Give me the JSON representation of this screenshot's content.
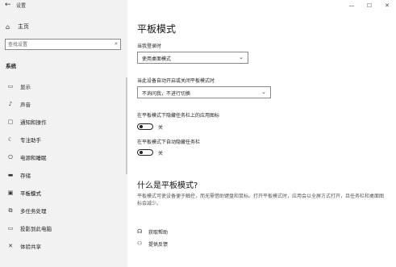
{
  "window": {
    "title": "设置",
    "back_icon": "back-arrow-icon",
    "controls": {
      "minimize": "—",
      "maximize": "☐",
      "close": "✕"
    }
  },
  "sidebar": {
    "home_label": "主页",
    "search_placeholder": "查找设置",
    "section_label": "系统",
    "items": [
      {
        "icon": "display-icon",
        "label": "显示"
      },
      {
        "icon": "sound-icon",
        "label": "声音"
      },
      {
        "icon": "notifications-icon",
        "label": "通知和操作"
      },
      {
        "icon": "focus-assist-icon",
        "label": "专注助手"
      },
      {
        "icon": "power-sleep-icon",
        "label": "电源和睡眠"
      },
      {
        "icon": "storage-icon",
        "label": "存储"
      },
      {
        "icon": "tablet-mode-icon",
        "label": "平板模式",
        "selected": true
      },
      {
        "icon": "multitasking-icon",
        "label": "多任务处理"
      },
      {
        "icon": "projecting-icon",
        "label": "投影到此电脑"
      },
      {
        "icon": "shared-experiences-icon",
        "label": "体验共享"
      }
    ]
  },
  "main": {
    "title": "平板模式",
    "signin_label": "当我登录时",
    "signin_value": "使用桌面模式",
    "switch_label": "当此设备自动开启或关闭平板模式时",
    "switch_value": "不询问我，不进行切换",
    "hide_icons_label": "在平板模式下隐藏任务栏上的应用图标",
    "hide_icons_state": "关",
    "autohide_label": "在平板模式下自动隐藏任务栏",
    "autohide_state": "关",
    "what_title": "什么是平板模式?",
    "what_desc": "平板模式可使设备便于触控，而无需借助键盘和鼠标。打开平板模式时，应用会以全屏方式打开，且任务栏和桌面图标会减少。",
    "links": [
      {
        "icon": "get-help-icon",
        "label": "获取帮助"
      },
      {
        "icon": "feedback-icon",
        "label": "提供反馈"
      }
    ]
  }
}
